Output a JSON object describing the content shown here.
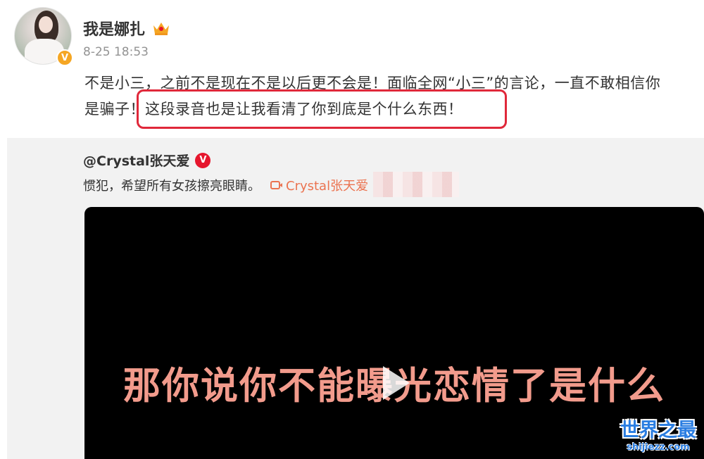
{
  "post": {
    "username": "我是娜扎",
    "timestamp": "8-25 18:53",
    "verified_badge": "V",
    "crown_icon": "crown-icon",
    "text_line1": "不是小三，之前不是现在不是以后更不会是！面临全网“小三”的言论，一直不敢相信你",
    "text_line2": "是骗子！这段录音也是让我看清了你到底是个什么东西！",
    "highlight_color": "#e0283a"
  },
  "repost": {
    "username": "@Crystal张天爱",
    "verified_badge": "V",
    "text": "惯犯，希望所有女孩擦亮眼睛。",
    "link_label": "Crystal张天爱",
    "link_color": "#eb7350",
    "video": {
      "subtitle": "那你说你不能曝光恋情了是什么",
      "subtitle_color": "#f29b8c",
      "play_icon": "play-icon"
    }
  },
  "watermark": {
    "main": "世界之最",
    "sub": "shijiezz.com",
    "color": "#2a7de1"
  }
}
